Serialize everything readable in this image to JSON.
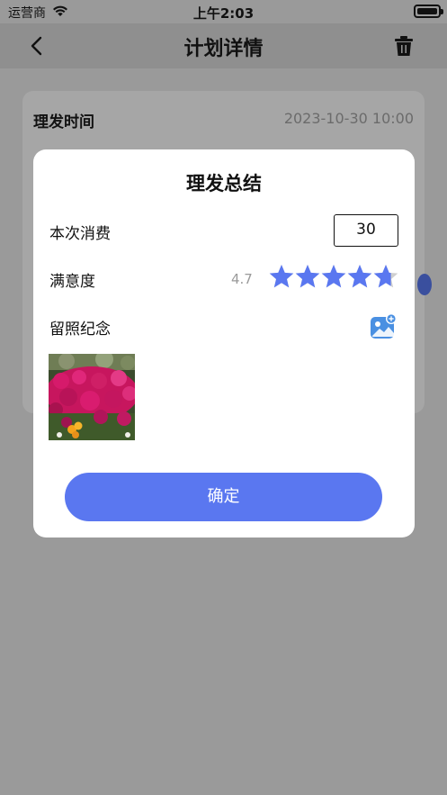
{
  "status_bar": {
    "carrier": "运营商",
    "time": "上午2:03"
  },
  "nav": {
    "title": "计划详情",
    "back_icon": "chevron-left-icon",
    "delete_icon": "trash-icon"
  },
  "background_card": {
    "label": "理发时间",
    "value": "2023-10-30 10:00"
  },
  "modal": {
    "title": "理发总结",
    "cost_label": "本次消费",
    "cost_value": "30",
    "rating_label": "满意度",
    "rating_value": "4.7",
    "rating_max": 5,
    "photo_label": "留照纪念",
    "add_photo_icon": "add-image-icon",
    "confirm_label": "确定"
  },
  "colors": {
    "accent": "#5a77f0",
    "star": "#5a77f0",
    "star_empty": "#cfcfcf",
    "overlay": "#9a9a9a"
  }
}
